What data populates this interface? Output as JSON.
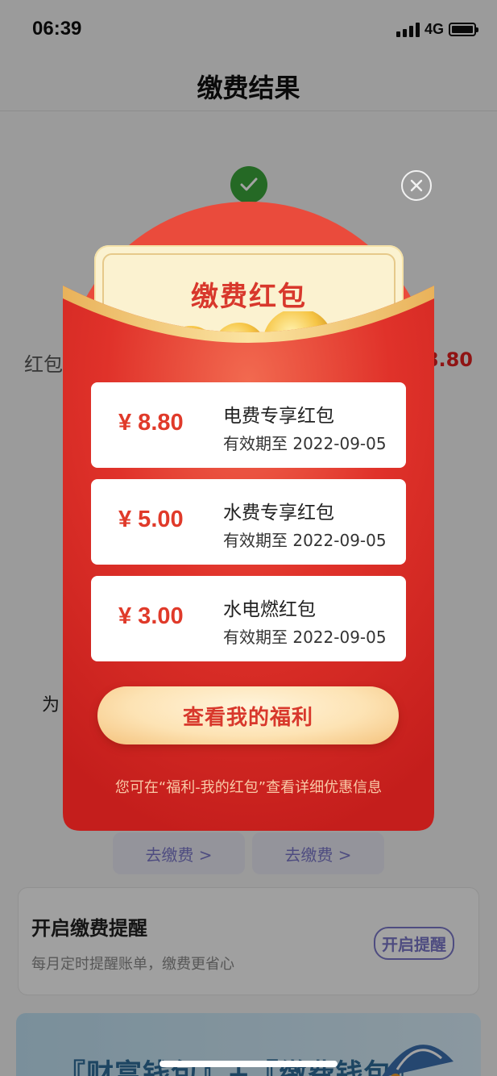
{
  "status_bar": {
    "time": "06:39",
    "network": "4G"
  },
  "header": {
    "title": "缴费结果"
  },
  "background": {
    "left_label": "红包",
    "right_amount": "8.80",
    "for_text": "为",
    "go_pay_buttons": [
      "去缴费 >",
      "去缴费 >"
    ],
    "reminder": {
      "title": "开启缴费提醒",
      "description": "每月定时提醒账单，缴费更省心",
      "button": "开启提醒"
    },
    "promo_banner": {
      "text": "『财富钱包』+『缴费钱包』"
    }
  },
  "popup": {
    "title": "缴费红包",
    "coupons": [
      {
        "amount": "¥ 8.80",
        "name": "电费专享红包",
        "expiry": "有效期至 2022-09-05"
      },
      {
        "amount": "¥ 5.00",
        "name": "水费专享红包",
        "expiry": "有效期至 2022-09-05"
      },
      {
        "amount": "¥ 3.00",
        "name": "水电燃红包",
        "expiry": "有效期至 2022-09-05"
      }
    ],
    "cta_button": "查看我的福利",
    "hint": "您可在“福利-我的红包”查看详细优惠信息"
  },
  "colors": {
    "packet_red": "#e0322a",
    "accent_red": "#e03a2a",
    "gold": "#f0c060",
    "purple": "#7b78c9",
    "success_green": "#3aa53a"
  },
  "icons": {
    "close": "close-circle-icon",
    "success": "checkmark-icon"
  }
}
